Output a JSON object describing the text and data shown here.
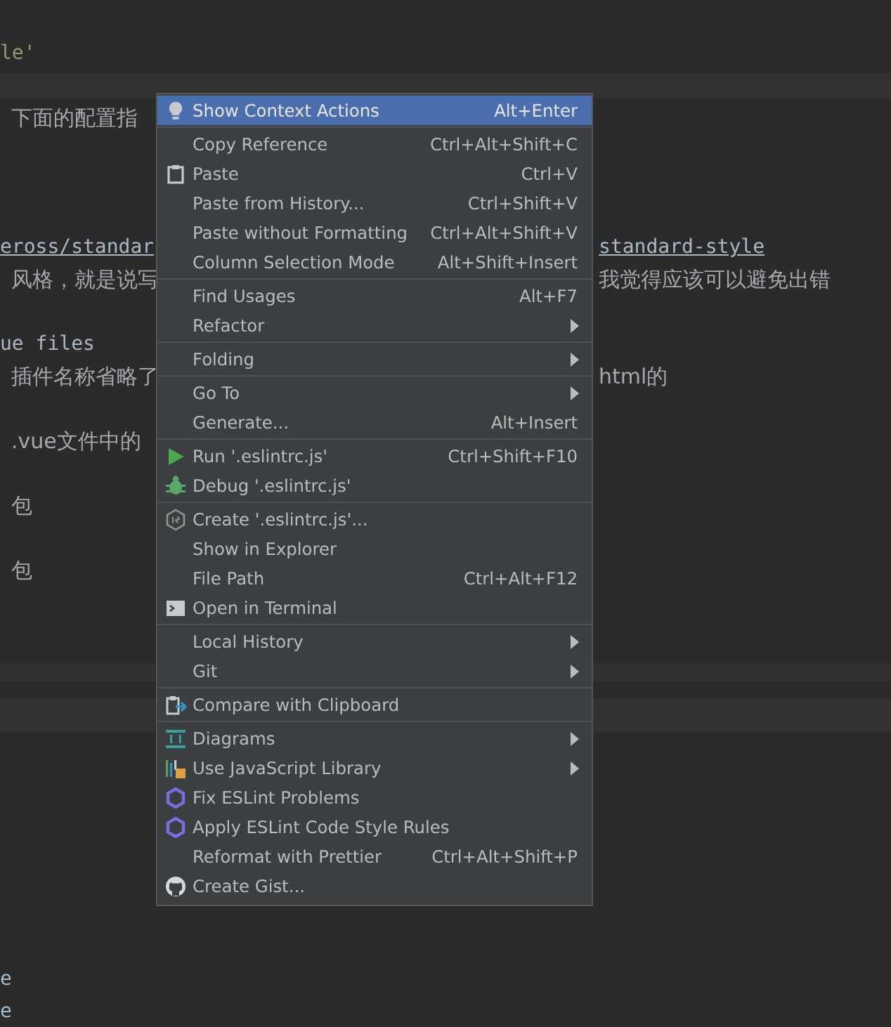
{
  "editor": {
    "lines": [
      {
        "left": "le'",
        "kind": "string"
      },
      {
        "left": "下面的配置指",
        "kind": "prose"
      },
      {
        "left": "eross/standar",
        "right": "standard-style",
        "kind": "link"
      },
      {
        "left": "风格，就是说写",
        "right": "我觉得应该可以避免出错",
        "kind": "prose"
      },
      {
        "left": "ue files",
        "kind": "code"
      },
      {
        "left": "插件名称省略了",
        "right": "html的",
        "kind": "prose"
      },
      {
        "left": " .vue文件中的",
        "kind": "prose"
      },
      {
        "left": "包",
        "kind": "prose"
      },
      {
        "left": "包",
        "kind": "prose"
      },
      {
        "left": "e",
        "kind": "code"
      },
      {
        "left": "e",
        "kind": "code"
      }
    ]
  },
  "context_menu": {
    "items": [
      {
        "kind": "item",
        "label": "Show Context Actions",
        "shortcut": "Alt+Enter",
        "selected": true
      },
      {
        "kind": "separator"
      },
      {
        "kind": "item",
        "label": "Copy Reference",
        "shortcut": "Ctrl+Alt+Shift+C",
        "selected": false
      },
      {
        "kind": "item",
        "label": "Paste",
        "shortcut": "Ctrl+V",
        "selected": false
      },
      {
        "kind": "item",
        "label": "Paste from History...",
        "shortcut": "Ctrl+Shift+V",
        "selected": false
      },
      {
        "kind": "item",
        "label": "Paste without Formatting",
        "shortcut": "Ctrl+Alt+Shift+V",
        "selected": false
      },
      {
        "kind": "item",
        "label": "Column Selection Mode",
        "shortcut": "Alt+Shift+Insert",
        "selected": false
      },
      {
        "kind": "separator"
      },
      {
        "kind": "item",
        "label": "Find Usages",
        "shortcut": "Alt+F7",
        "selected": false
      },
      {
        "kind": "item",
        "label": "Refactor",
        "submenu": true,
        "selected": false
      },
      {
        "kind": "separator"
      },
      {
        "kind": "item",
        "label": "Folding",
        "submenu": true,
        "selected": false
      },
      {
        "kind": "separator"
      },
      {
        "kind": "item",
        "label": "Go To",
        "submenu": true,
        "selected": false
      },
      {
        "kind": "item",
        "label": "Generate...",
        "shortcut": "Alt+Insert",
        "selected": false
      },
      {
        "kind": "separator"
      },
      {
        "kind": "item",
        "label": "Run '.eslintrc.js'",
        "shortcut": "Ctrl+Shift+F10",
        "selected": false
      },
      {
        "kind": "item",
        "label": "Debug '.eslintrc.js'",
        "selected": false
      },
      {
        "kind": "separator"
      },
      {
        "kind": "item",
        "label": "Create '.eslintrc.js'...",
        "selected": false
      },
      {
        "kind": "item",
        "label": "Show in Explorer",
        "selected": false
      },
      {
        "kind": "item",
        "label": "File Path",
        "shortcut": "Ctrl+Alt+F12",
        "selected": false
      },
      {
        "kind": "item",
        "label": "Open in Terminal",
        "selected": false
      },
      {
        "kind": "separator"
      },
      {
        "kind": "item",
        "label": "Local History",
        "submenu": true,
        "selected": false
      },
      {
        "kind": "item",
        "label": "Git",
        "submenu": true,
        "selected": false
      },
      {
        "kind": "separator"
      },
      {
        "kind": "item",
        "label": "Compare with Clipboard",
        "selected": false
      },
      {
        "kind": "separator"
      },
      {
        "kind": "item",
        "label": "Diagrams",
        "submenu": true,
        "selected": false
      },
      {
        "kind": "item",
        "label": "Use JavaScript Library",
        "submenu": true,
        "selected": false
      },
      {
        "kind": "item",
        "label": "Fix ESLint Problems",
        "selected": false
      },
      {
        "kind": "item",
        "label": "Apply ESLint Code Style Rules",
        "selected": false
      },
      {
        "kind": "item",
        "label": "Reformat with Prettier",
        "shortcut": "Ctrl+Alt+Shift+P",
        "selected": false
      },
      {
        "kind": "item",
        "label": "Create Gist...",
        "selected": false
      }
    ]
  }
}
